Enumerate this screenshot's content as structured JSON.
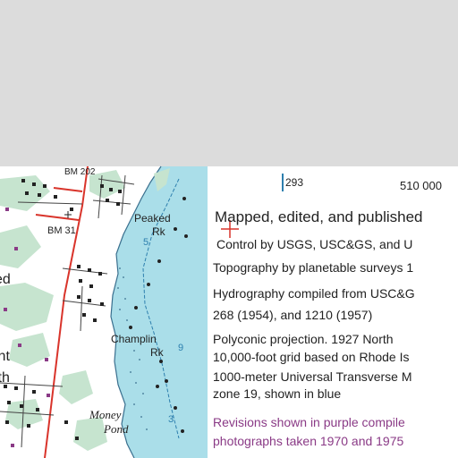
{
  "map": {
    "labels": {
      "peaked": "Peaked",
      "peaked_rk": "Rk",
      "champlin": "Champlin",
      "champlin_rk": "Rk",
      "benchmark": "BM 31",
      "money": "Money",
      "pond": "Pond",
      "edge_left_1": "ed",
      "edge_left_2": "int",
      "edge_left_3": "ith",
      "bm_top": "BM 202",
      "depth_5": "5",
      "depth_9": "9",
      "depth_3": "3"
    },
    "collar": {
      "tick_293": "293",
      "tick_510": "510 000",
      "mapped": "Mapped, edited, and published",
      "control": "Control by USGS, USC&GS, and U",
      "topography": "Topography by planetable surveys 1",
      "hydrography": "Hydrography compiled from USC&G",
      "hydro_charts": "268 (1954), and 1210 (1957)",
      "projection": "Polyconic projection.   1927 North",
      "grid": "10,000-foot grid based on Rhode Is",
      "utm": "1000-meter Universal Transverse M",
      "zone": "zone 19, shown in blue",
      "revisions_1": "Revisions shown in purple compile",
      "revisions_2": "photographs taken 1970 and 1975"
    },
    "colors": {
      "water": "#aadee9",
      "land": "#ffffff",
      "vegetation": "#c6e4cf",
      "road": "#d9342b",
      "purple": "#8a3a86",
      "background": "#dcdcdc",
      "text": "#222222"
    }
  }
}
